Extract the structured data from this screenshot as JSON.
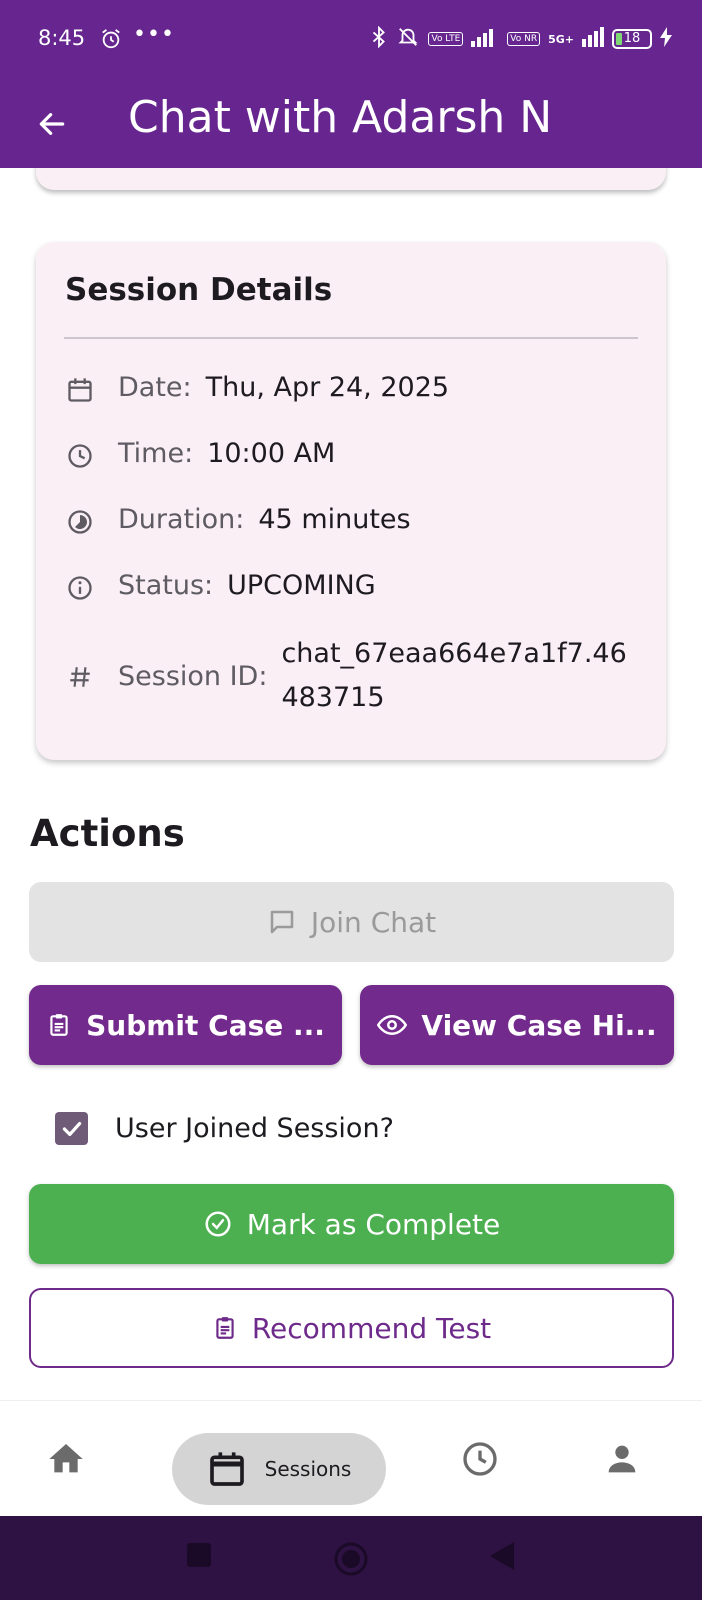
{
  "status_bar": {
    "time": "8:45",
    "dots": "•••",
    "volte": "Vo LTE",
    "vonr": "Vo NR",
    "network": "5G+",
    "battery": "18",
    "icons": [
      "alarm-icon",
      "bluetooth-icon",
      "mute-icon",
      "signal-icon",
      "charging-icon"
    ]
  },
  "app_bar": {
    "title": "Chat with Adarsh N",
    "back_icon": "arrow-back-icon"
  },
  "session_details": {
    "title": "Session Details",
    "rows": [
      {
        "icon": "calendar-icon",
        "label": "Date:",
        "value": "Thu, Apr 24, 2025"
      },
      {
        "icon": "clock-icon",
        "label": "Time:",
        "value": "10:00 AM"
      },
      {
        "icon": "timelapse-icon",
        "label": "Duration:",
        "value": "45 minutes"
      },
      {
        "icon": "info-icon",
        "label": "Status:",
        "value": "UPCOMING"
      },
      {
        "icon": "hash-icon",
        "label": "Session ID:",
        "value": "chat_67eaa664e7a1f7.46483715"
      }
    ]
  },
  "actions": {
    "heading": "Actions",
    "join_chat": "Join Chat",
    "submit_case": "Submit Case ...",
    "view_case": "View Case Hi...",
    "user_joined_label": "User Joined Session?",
    "user_joined_checked": true,
    "mark_complete": "Mark as Complete",
    "recommend_test": "Recommend Test"
  },
  "bottom_nav": {
    "items": [
      {
        "icon": "home-icon",
        "label": ""
      },
      {
        "icon": "calendar-icon",
        "label": "Sessions",
        "active": true
      },
      {
        "icon": "history-icon",
        "label": ""
      },
      {
        "icon": "person-icon",
        "label": ""
      }
    ]
  },
  "colors": {
    "primary": "#67268f",
    "button_purple": "#722a8d",
    "success": "#4cb050",
    "card_bg": "#fbeff6",
    "disabled_bg": "#e3e3e3"
  }
}
